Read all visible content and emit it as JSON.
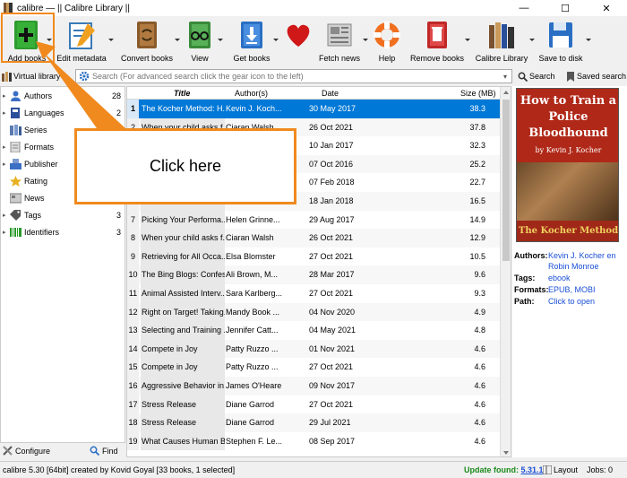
{
  "window": {
    "title": "calibre — || Calibre Library ||",
    "min": "—",
    "max": "☐",
    "close": "✕"
  },
  "toolbar": {
    "add_books": "Add books",
    "edit_metadata": "Edit metadata",
    "convert_books": "Convert books",
    "view": "View",
    "get_books": "Get books",
    "fetch_news": "Fetch news",
    "help": "Help",
    "remove_books": "Remove books",
    "calibre_library": "Calibre Library",
    "save_to_disk": "Save to disk"
  },
  "search": {
    "virtual_library": "Virtual library",
    "placeholder": "Search (For advanced search click the gear icon to the left)",
    "search_button": "Search",
    "saved_search": "Saved search"
  },
  "tag_browser": {
    "items": [
      {
        "name": "Authors",
        "count": "28",
        "color": "#3a6fc4"
      },
      {
        "name": "Languages",
        "count": "2",
        "color": "#2a4f9a"
      },
      {
        "name": "Series",
        "count": "",
        "color": "#5a7ab0"
      },
      {
        "name": "Formats",
        "count": "",
        "color": "#888888"
      },
      {
        "name": "Publisher",
        "count": "",
        "color": "#3a6fc4"
      },
      {
        "name": "Rating",
        "count": "",
        "color": "#e8b020"
      },
      {
        "name": "News",
        "count": "",
        "color": "#777777"
      },
      {
        "name": "Tags",
        "count": "3",
        "color": "#555555"
      },
      {
        "name": "Identifiers",
        "count": "3",
        "color": "#2a9a2a"
      }
    ],
    "configure": "Configure",
    "find": "Find"
  },
  "booklist": {
    "headers": {
      "title": "Title",
      "authors": "Author(s)",
      "date": "Date",
      "size": "Size (MB)"
    },
    "rows": [
      {
        "n": "1",
        "title": "The Kocher Method: H...",
        "author": "Kevin J. Koch...",
        "date": "30 May 2017",
        "size": "38.3"
      },
      {
        "n": "2",
        "title": "When your child asks f...",
        "author": "Ciaran Walsh",
        "date": "26 Oct 2021",
        "size": "37.8"
      },
      {
        "n": "3",
        "title": "",
        "author": "",
        "date": "10 Jan 2017",
        "size": "32.3"
      },
      {
        "n": "4",
        "title": "",
        "author": "",
        "date": "07 Oct 2016",
        "size": "25.2"
      },
      {
        "n": "5",
        "title": "",
        "author": "",
        "date": "07 Feb 2018",
        "size": "22.7"
      },
      {
        "n": "6",
        "title": "",
        "author": "",
        "date": "18 Jan 2018",
        "size": "16.5"
      },
      {
        "n": "7",
        "title": "Picking Your Performa...",
        "author": "Helen Grinne...",
        "date": "29 Aug 2017",
        "size": "14.9"
      },
      {
        "n": "8",
        "title": "When your child asks f...",
        "author": "Ciaran Walsh",
        "date": "26 Oct 2021",
        "size": "12.9"
      },
      {
        "n": "9",
        "title": "Retrieving for All Occa...",
        "author": "Elsa Blomster",
        "date": "27 Oct 2021",
        "size": "10.5"
      },
      {
        "n": "10",
        "title": "The Bing Blogs: Confes...",
        "author": "Ali Brown, M...",
        "date": "28 Mar 2017",
        "size": "9.6"
      },
      {
        "n": "11",
        "title": "Animal Assisted Interv...",
        "author": "Sara Karlberg...",
        "date": "27 Oct 2021",
        "size": "9.3"
      },
      {
        "n": "12",
        "title": "Right on Target! Taking...",
        "author": "Mandy Book ...",
        "date": "04 Nov 2020",
        "size": "4.9"
      },
      {
        "n": "13",
        "title": "Selecting and Training ...",
        "author": "Jennifer Catt...",
        "date": "04 May 2021",
        "size": "4.8"
      },
      {
        "n": "14",
        "title": "Compete in Joy",
        "author": "Patty Ruzzo ...",
        "date": "01 Nov 2021",
        "size": "4.6"
      },
      {
        "n": "15",
        "title": "Compete in Joy",
        "author": "Patty Ruzzo ...",
        "date": "27 Oct 2021",
        "size": "4.6"
      },
      {
        "n": "16",
        "title": "Aggressive Behavior in ...",
        "author": "James O'Heare",
        "date": "09 Nov 2017",
        "size": "4.6"
      },
      {
        "n": "17",
        "title": "Stress Release",
        "author": "Diane Garrod",
        "date": "27 Oct 2021",
        "size": "4.6"
      },
      {
        "n": "18",
        "title": "Stress Release",
        "author": "Diane Garrod",
        "date": "29 Jul 2021",
        "size": "4.6"
      },
      {
        "n": "19",
        "title": "What Causes Human B...",
        "author": "Stephen F. Le...",
        "date": "08 Sep 2017",
        "size": "4.6"
      }
    ]
  },
  "details": {
    "cover_title": "How to Train a Police Bloodhound",
    "cover_line1": "How to Train a",
    "cover_line2": "Police",
    "cover_line3": "Bloodhound",
    "cover_author": "by Kevin J. Kocher",
    "cover_bottom": "The Kocher Method",
    "authors_label": "Authors:",
    "authors_value1": "Kevin J. Kocher en",
    "authors_value2": "Robin Monroe",
    "tags_label": "Tags:",
    "tags_value": "ebook",
    "formats_label": "Formats:",
    "formats_value": "EPUB, MOBI",
    "path_label": "Path:",
    "path_value": "Click to open"
  },
  "status": {
    "left": "calibre 5.30 [64bit] created by Kovid Goyal   [33 books, 1 selected]",
    "update_label": "Update found:",
    "update_version": "5.31.1",
    "layout": "Layout",
    "jobs": "Jobs: 0"
  },
  "annotation": {
    "callout": "Click here",
    "color": "#f08a1e"
  }
}
